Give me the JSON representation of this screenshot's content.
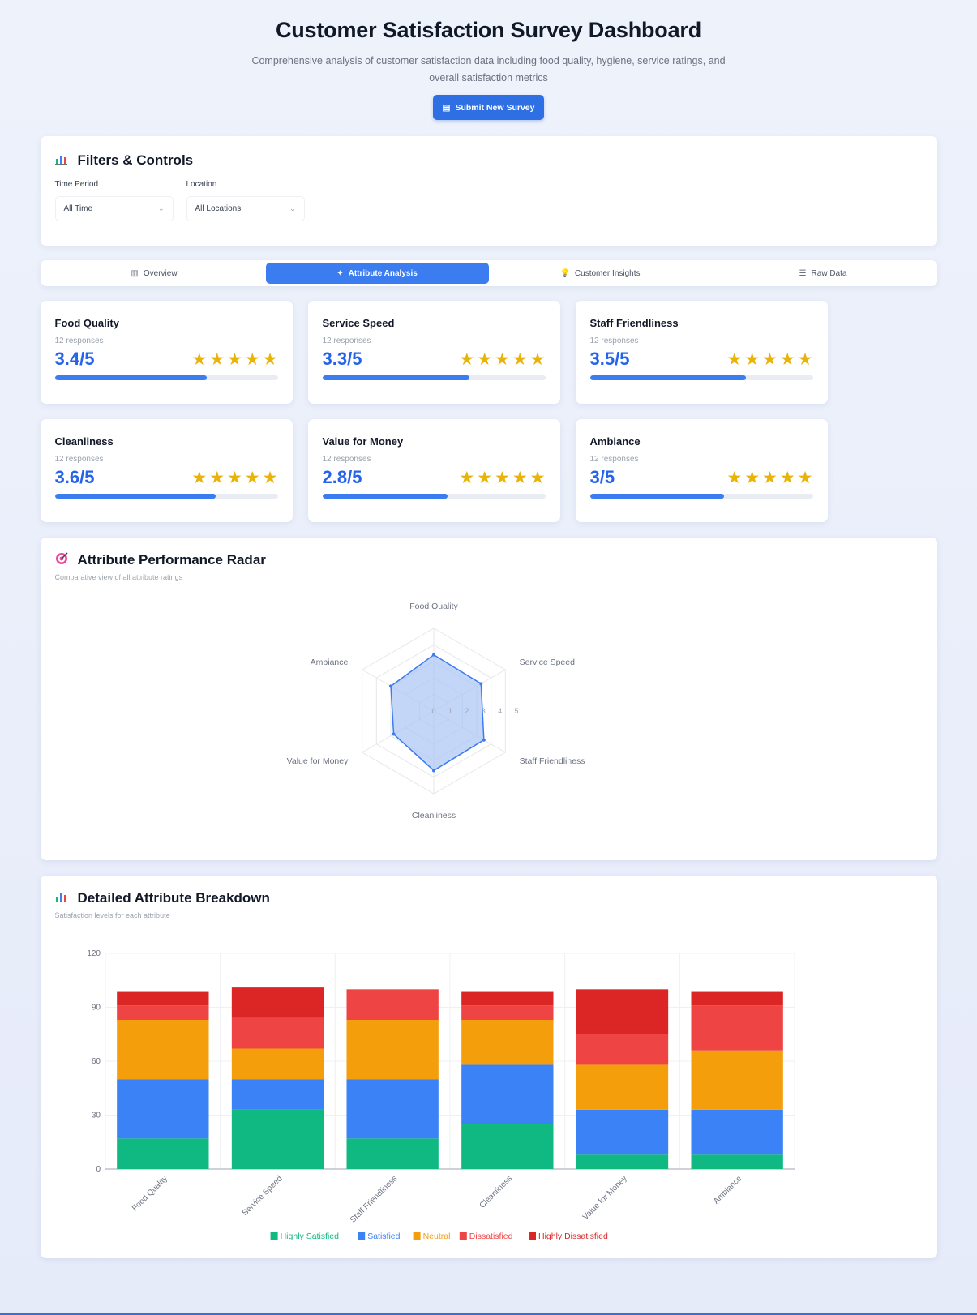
{
  "header": {
    "title": "Customer Satisfaction Survey Dashboard",
    "description": "Comprehensive analysis of customer satisfaction data including food quality, hygiene, service ratings, and overall satisfaction metrics",
    "submit_button": "Submit New Survey",
    "submit_icon": "clipboard-icon"
  },
  "filters": {
    "title": "Filters & Controls",
    "title_icon": "bar-chart-icon",
    "time_period": {
      "label": "Time Period",
      "value": "All Time"
    },
    "location": {
      "label": "Location",
      "value": "All Locations"
    }
  },
  "tabs": [
    {
      "label": "Overview",
      "icon": "chart-icon",
      "active": false
    },
    {
      "label": "Attribute Analysis",
      "icon": "sparkle-icon",
      "active": true
    },
    {
      "label": "Customer Insights",
      "icon": "lightbulb-icon",
      "active": false
    },
    {
      "label": "Raw Data",
      "icon": "list-icon",
      "active": false
    }
  ],
  "metrics": [
    {
      "name": "Food Quality",
      "responses": "12 responses",
      "score": "3.4/5",
      "stars": 5,
      "progress": 0.68
    },
    {
      "name": "Service Speed",
      "responses": "12 responses",
      "score": "3.3/5",
      "stars": 5,
      "progress": 0.66
    },
    {
      "name": "Staff Friendliness",
      "responses": "12 responses",
      "score": "3.5/5",
      "stars": 5,
      "progress": 0.7
    },
    {
      "name": "Cleanliness",
      "responses": "12 responses",
      "score": "3.6/5",
      "stars": 5,
      "progress": 0.72
    },
    {
      "name": "Value for Money",
      "responses": "12 responses",
      "score": "2.8/5",
      "stars": 5,
      "progress": 0.56
    },
    {
      "name": "Ambiance",
      "responses": "12 responses",
      "score": "3/5",
      "stars": 5,
      "progress": 0.6
    }
  ],
  "radar": {
    "title": "Attribute Performance Radar",
    "title_icon": "target-icon",
    "subtitle": "Comparative view of all attribute ratings"
  },
  "breakdown": {
    "title": "Detailed Attribute Breakdown",
    "title_icon": "bar-chart-icon",
    "subtitle": "Satisfaction levels for each attribute"
  },
  "colors": {
    "accent": "#3b7cf0",
    "star": "#eab308",
    "highly_satisfied": "#10b981",
    "satisfied": "#3b82f6",
    "neutral": "#f59e0b",
    "dissatisfied": "#ef4444",
    "highly_dissatisfied": "#dc2626"
  },
  "chart_data": [
    {
      "type": "radar",
      "categories": [
        "Food Quality",
        "Service Speed",
        "Staff Friendliness",
        "Cleanliness",
        "Value for Money",
        "Ambiance"
      ],
      "values": [
        3.4,
        3.3,
        3.5,
        3.6,
        2.8,
        3
      ],
      "rlim": [
        0,
        5
      ],
      "tick_labels": [
        "0",
        "1",
        "2",
        "3",
        "4",
        "5"
      ],
      "fill_color": "#a9c4f5",
      "line_color": "#3b7cf0"
    },
    {
      "type": "bar",
      "stacked": true,
      "categories": [
        "Food Quality",
        "Service Speed",
        "Staff Friendliness",
        "Cleanliness",
        "Value for Money",
        "Ambiance"
      ],
      "series": [
        {
          "name": "Highly Satisfied",
          "values": [
            17,
            33,
            17,
            25,
            8,
            8
          ]
        },
        {
          "name": "Satisfied",
          "values": [
            33,
            17,
            33,
            33,
            25,
            25
          ]
        },
        {
          "name": "Neutral",
          "values": [
            33,
            17,
            33,
            25,
            25,
            33
          ]
        },
        {
          "name": "Dissatisfied",
          "values": [
            8,
            17,
            17,
            8,
            17,
            25
          ]
        },
        {
          "name": "Highly Dissatisfied",
          "values": [
            8,
            17,
            0,
            8,
            25,
            8
          ]
        }
      ],
      "ylim": [
        0,
        120
      ],
      "yticks": [
        0,
        30,
        60,
        90,
        120
      ],
      "grid": true,
      "legend": "bottom"
    }
  ]
}
